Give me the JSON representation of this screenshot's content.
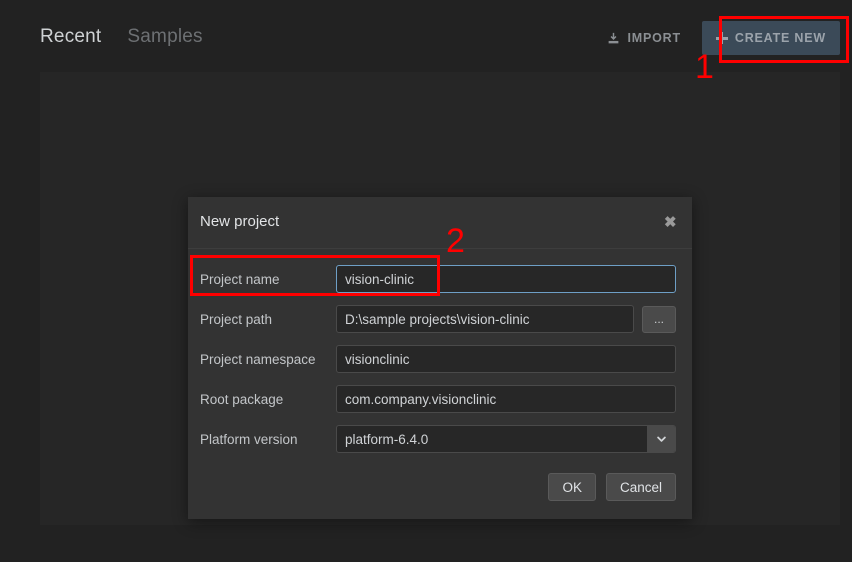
{
  "topbar": {
    "tabs": [
      {
        "label": "Recent",
        "active": true
      },
      {
        "label": "Samples",
        "active": false
      }
    ],
    "import_button": {
      "label": "IMPORT",
      "icon": "import-icon"
    },
    "create_button": {
      "label": "CREATE NEW",
      "icon": "plus-icon"
    }
  },
  "dialog": {
    "title": "New project",
    "close_label": "✖",
    "fields": [
      {
        "label": "Project name",
        "value": "vision-clinic",
        "focused": true
      },
      {
        "label": "Project path",
        "value": "D:\\sample projects\\vision-clinic",
        "browse_label": "..."
      },
      {
        "label": "Project namespace",
        "value": "visionclinic"
      },
      {
        "label": "Root package",
        "value": "com.company.visionclinic"
      },
      {
        "label": "Platform version",
        "value": "platform-6.4.0"
      }
    ],
    "ok_label": "OK",
    "cancel_label": "Cancel"
  },
  "annotations": [
    {
      "number": "1",
      "target": "create-new-button"
    },
    {
      "number": "2",
      "target": "project-name-row"
    }
  ],
  "colors": {
    "page_background": "#222222",
    "panel_background": "#262626",
    "dialog_background": "#333333",
    "accent_button": "#3b4a58",
    "focus_border": "#6e9fc6",
    "annotation": "#ff0000"
  }
}
